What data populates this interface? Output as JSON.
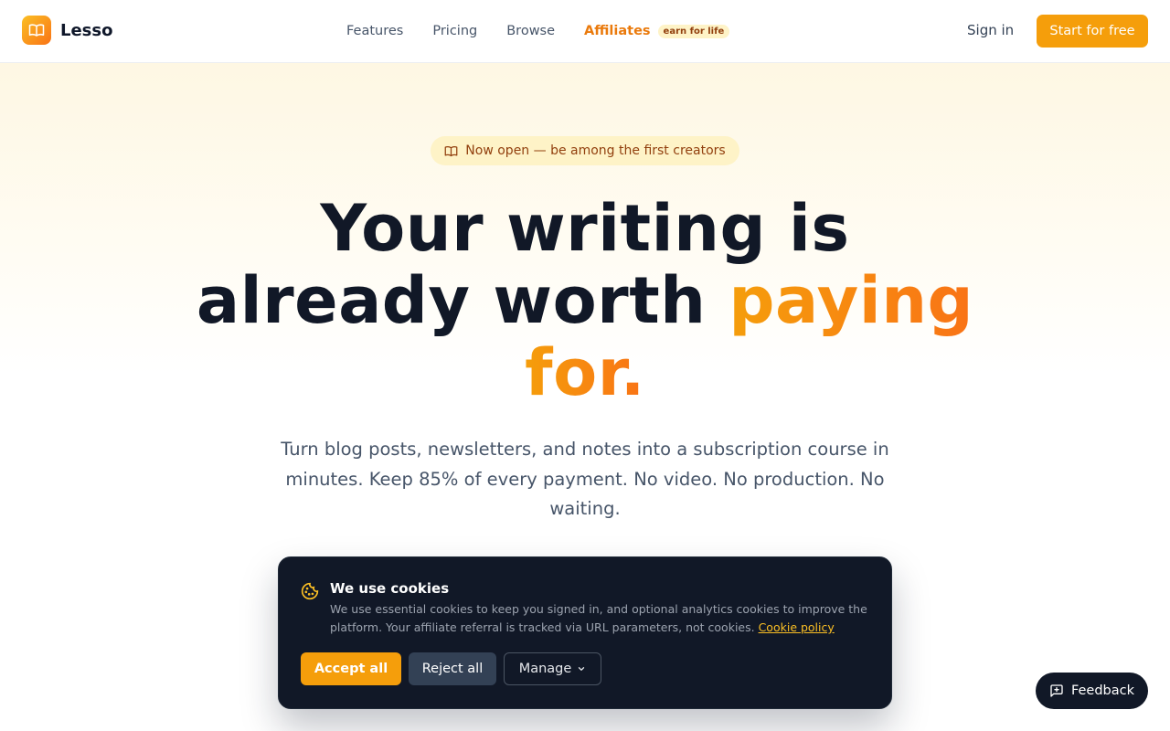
{
  "brand": {
    "name": "Lesso",
    "icon": "book-icon"
  },
  "nav": {
    "features": "Features",
    "pricing": "Pricing",
    "browse": "Browse",
    "affiliates": "Affiliates",
    "affiliates_badge": "earn for life"
  },
  "auth": {
    "signin": "Sign in",
    "start": "Start for free"
  },
  "hero": {
    "pill": "Now open — be among the first creators",
    "headline_line1": "Your writing is",
    "headline_line2_plain": "already worth ",
    "headline_line2_highlight": "paying",
    "headline_line3_highlight": "for.",
    "subtitle": "Turn blog posts, newsletters, and notes into a subscription course in minutes. Keep 85% of every payment. No video. No production. No waiting."
  },
  "cookies": {
    "title": "We use cookies",
    "body": "We use essential cookies to keep you signed in, and optional analytics cookies to improve the platform. Your affiliate referral is tracked via URL parameters, not cookies. ",
    "policy_link": "Cookie policy",
    "accept": "Accept all",
    "reject": "Reject all",
    "manage": "Manage"
  },
  "feedback": {
    "label": "Feedback"
  },
  "colors": {
    "accent": "#f59e0b",
    "accent_dark": "#f97316",
    "banner": "#111827"
  }
}
